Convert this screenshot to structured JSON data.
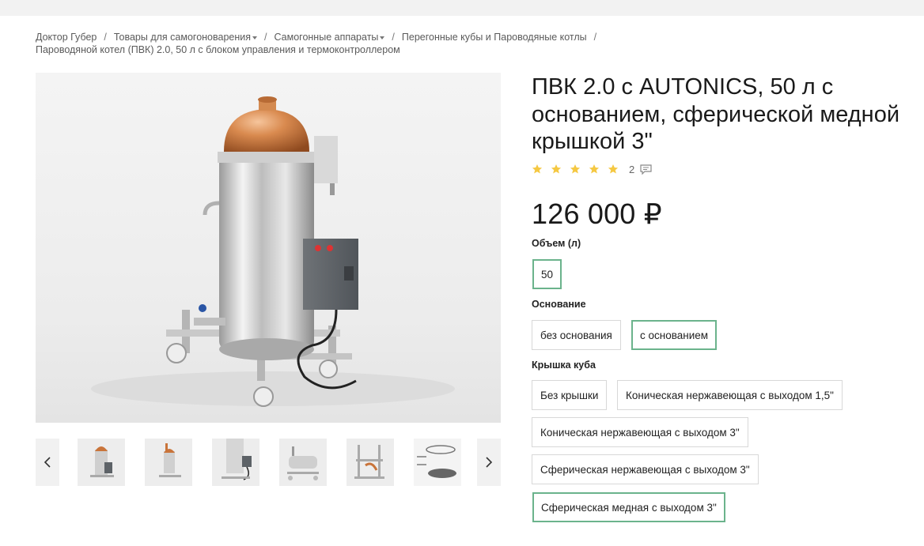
{
  "breadcrumb": {
    "items": [
      {
        "label": "Доктор Губер",
        "dropdown": false
      },
      {
        "label": "Товары для самогоноварения",
        "dropdown": true
      },
      {
        "label": "Самогонные аппараты",
        "dropdown": true
      },
      {
        "label": "Перегонные кубы и Пароводяные котлы",
        "dropdown": false
      }
    ],
    "separator": "/",
    "current": "Пароводяной котел (ПВК) 2.0, 50 л с блоком управления и термоконтроллером"
  },
  "gallery": {
    "thumbnail_count": 6,
    "prev_icon": "chevron-left-icon",
    "next_icon": "chevron-right-icon"
  },
  "product": {
    "title": "ПВК 2.0 с AUTONICS, 50 л с основанием, сферической медной крышкой 3\"",
    "rating": 5,
    "rating_max": 5,
    "review_count": "2",
    "price": "126 000 ₽"
  },
  "options": {
    "volume": {
      "label": "Объем (л)",
      "values": [
        "50"
      ],
      "selected": "50"
    },
    "base": {
      "label": "Основание",
      "values": [
        "без основания",
        "с основанием"
      ],
      "selected": "с основанием"
    },
    "lid": {
      "label": "Крышка куба",
      "values": [
        "Без крышки",
        "Коническая нержавеющая с выходом 1,5\"",
        "Коническая нержавеющая с выходом 3\"",
        "Сферическая нержавеющая с выходом 3\"",
        "Сферическая медная с выходом 3\""
      ],
      "selected": "Сферическая медная с выходом 3\""
    }
  },
  "colors": {
    "accent": "#6bb38c",
    "star": "#f5c842",
    "copper": "#c9743a"
  }
}
